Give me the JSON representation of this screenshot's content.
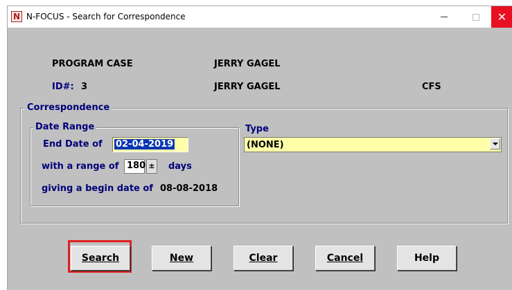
{
  "window": {
    "icon_letter": "N",
    "title": "N-FOCUS - Search for Correspondence",
    "close_glyph": "✕"
  },
  "header": {
    "program_case_label": "PROGRAM CASE",
    "program_case_name": "JERRY GAGEL",
    "id_label": "ID#:",
    "id_value": "3",
    "id_name": "JERRY GAGEL",
    "program_code": "CFS"
  },
  "correspondence": {
    "group_label": "Correspondence",
    "date_range": {
      "group_label": "Date Range",
      "end_date_label": "End Date of",
      "end_date_value": "02-04-2019",
      "range_label": "with a range of",
      "range_value": "180",
      "spin_glyph": "±",
      "days_label": "days",
      "begin_label": "giving a begin date of",
      "begin_value": "08-08-2018"
    },
    "type": {
      "label": "Type",
      "selected": "(NONE)"
    }
  },
  "buttons": {
    "search": "Search",
    "new": "New",
    "clear": "Clear",
    "cancel": "Cancel",
    "help": "Help"
  },
  "colors": {
    "dialog_bg": "#c0c0c0",
    "field_bg": "#ffffa8",
    "selection": "#0a36b4",
    "label_blue": "#00007a",
    "highlight_red": "#e02020",
    "close_red": "#e81123"
  }
}
